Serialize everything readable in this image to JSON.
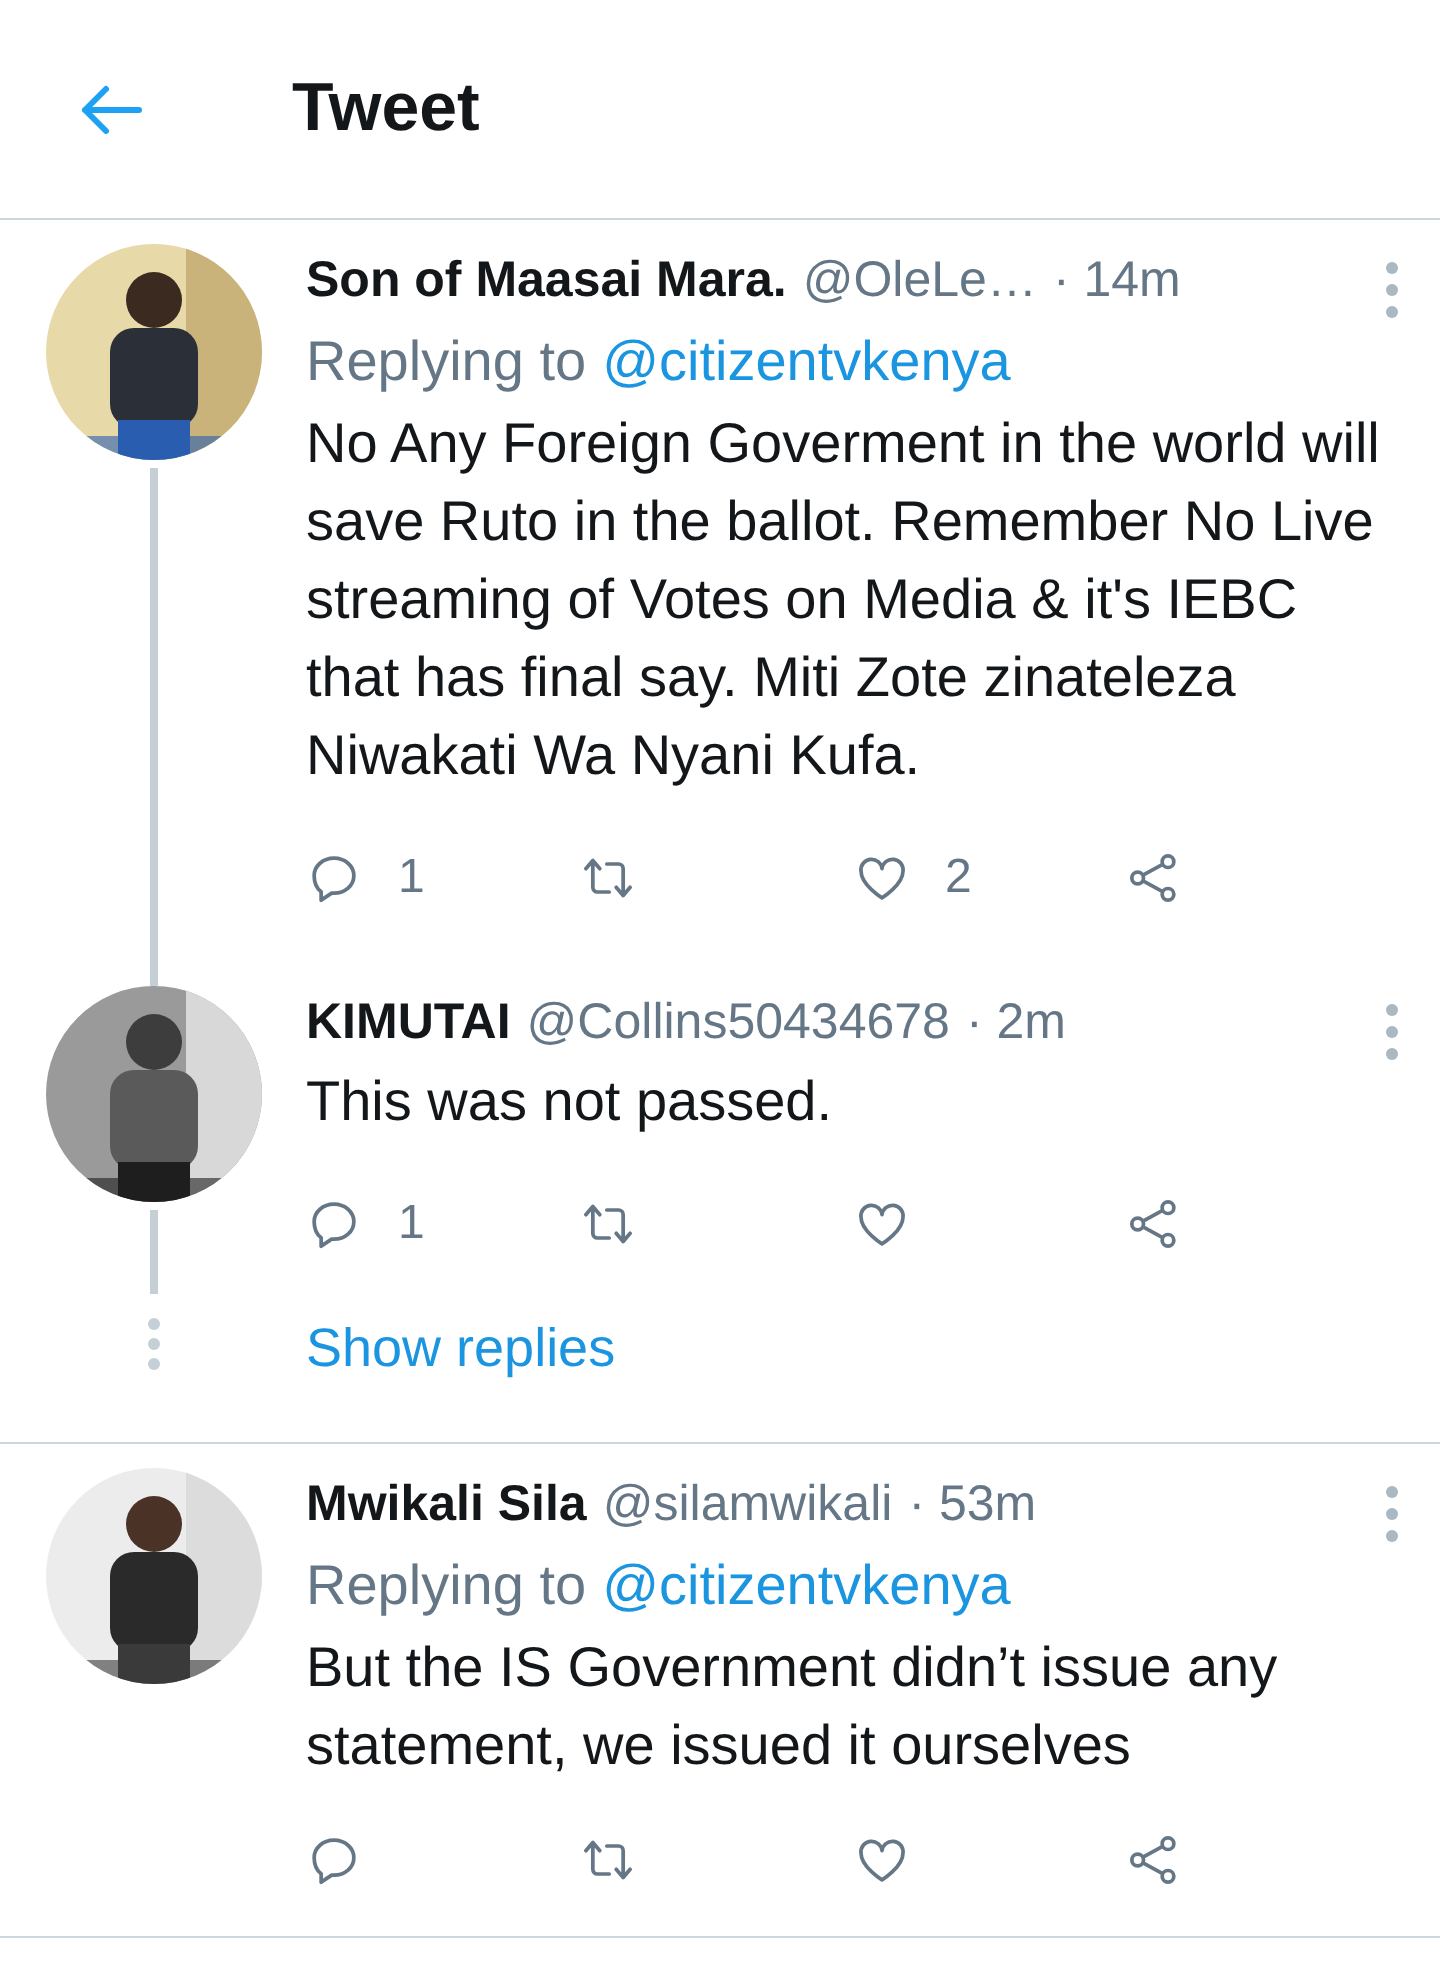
{
  "header": {
    "title": "Tweet"
  },
  "tweets": [
    {
      "name": "Son of Maasai Mara.",
      "handle": "@OleLe…",
      "time": "· 14m",
      "replying_label": "Replying to",
      "replying_to": "@citizentvkenya",
      "body": "No Any Foreign Goverment in the world will save Ruto in the ballot. Remember No Live streaming of Votes on Media & it's IEBC that has final say. Miti Zote zinateleza Niwakati Wa Nyani Kufa.",
      "replies": "1",
      "likes": "2",
      "connects_up": false,
      "connects_down": true
    },
    {
      "name": "KIMUTAI",
      "handle": "@Collins50434678",
      "time": "· 2m",
      "body": "This was not passed.",
      "replies": "1",
      "connects_up": true,
      "connects_down": true,
      "show_replies": "Show replies"
    },
    {
      "name": "Mwikali Sila",
      "handle": "@silamwikali",
      "time": "· 53m",
      "replying_label": "Replying to",
      "replying_to": "@citizentvkenya",
      "body": "But the IS Government didn’t issue any statement, we issued it ourselves",
      "connects_up": false,
      "connects_down": false
    }
  ]
}
